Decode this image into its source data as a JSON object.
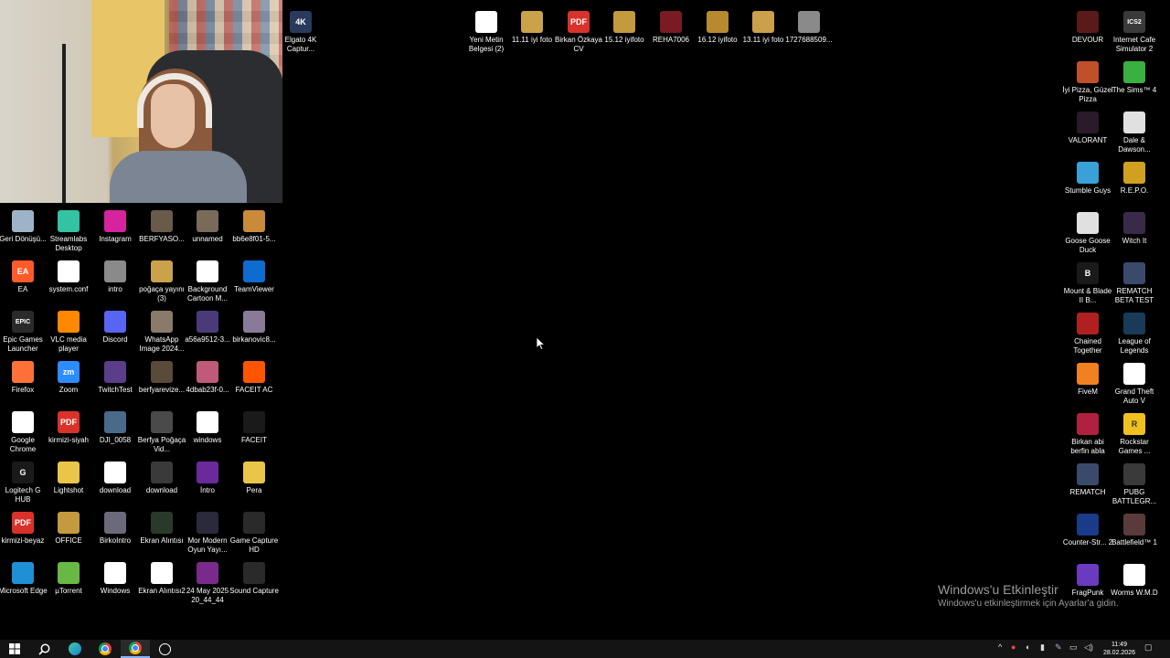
{
  "desktop": {
    "top_icons": [
      {
        "label": "Elgato 4K Captur...",
        "color": "#2a3a5c",
        "glyph": "4K"
      },
      {
        "label": "Yeni Metin Belgesi (2)",
        "color": "#ffffff",
        "glyph": ""
      },
      {
        "label": "11.11 iyi foto",
        "color": "#c9a24a",
        "glyph": ""
      },
      {
        "label": "Birkan Özkaya CV",
        "color": "#d9322a",
        "glyph": "PDF"
      },
      {
        "label": "15.12 iyifoto",
        "color": "#c49a3e",
        "glyph": ""
      },
      {
        "label": "REHA7006",
        "color": "#7a1a22",
        "glyph": ""
      },
      {
        "label": "16.12 iyifoto",
        "color": "#b88a30",
        "glyph": ""
      },
      {
        "label": "13.11 iyi foto",
        "color": "#caa04a",
        "glyph": ""
      },
      {
        "label": "1727688509...",
        "color": "#8a8a8a",
        "glyph": ""
      }
    ],
    "left_icons": [
      [
        {
          "label": "Geri Dönüşü...",
          "color": "#9fb3c8",
          "glyph": ""
        },
        {
          "label": "EA",
          "color": "#ff5a2a",
          "glyph": "EA"
        },
        {
          "label": "Epic Games Launcher",
          "color": "#2a2a2a",
          "glyph": "EPIC"
        },
        {
          "label": "Firefox",
          "color": "#ff7139",
          "glyph": ""
        },
        {
          "label": "Google Chrome",
          "color": "#ffffff",
          "glyph": ""
        },
        {
          "label": "Logitech G HUB",
          "color": "#1a1a1a",
          "glyph": "G"
        },
        {
          "label": "kirmizi-beyaz",
          "color": "#d9322a",
          "glyph": "PDF"
        },
        {
          "label": "Microsoft Edge",
          "color": "#1f8fd6",
          "glyph": ""
        }
      ],
      [
        {
          "label": "Streamlabs Desktop",
          "color": "#31c3a2",
          "glyph": ""
        },
        {
          "label": "system.conf",
          "color": "#ffffff",
          "glyph": ""
        },
        {
          "label": "VLC media player",
          "color": "#ff8800",
          "glyph": ""
        },
        {
          "label": "Zoom",
          "color": "#2d8cff",
          "glyph": "zm"
        },
        {
          "label": "kirmizi-siyah",
          "color": "#d9322a",
          "glyph": "PDF"
        },
        {
          "label": "Lightshot",
          "color": "#e9c54a",
          "glyph": ""
        },
        {
          "label": "OFFICE",
          "color": "#c49a3e",
          "glyph": ""
        },
        {
          "label": "µTorrent",
          "color": "#68b846",
          "glyph": ""
        }
      ],
      [
        {
          "label": "Instagram",
          "color": "#d6249f",
          "glyph": ""
        },
        {
          "label": "intro",
          "color": "#8a8a8a",
          "glyph": ""
        },
        {
          "label": "Discord",
          "color": "#5865f2",
          "glyph": ""
        },
        {
          "label": "TwitchTest",
          "color": "#5a3e8a",
          "glyph": ""
        },
        {
          "label": "DJI_0058",
          "color": "#4a6a8a",
          "glyph": ""
        },
        {
          "label": "download",
          "color": "#ffffff",
          "glyph": ""
        },
        {
          "label": "BirkoIntro",
          "color": "#6a6a7a",
          "glyph": ""
        },
        {
          "label": "Windows",
          "color": "#ffffff",
          "glyph": ""
        }
      ],
      [
        {
          "label": "BERFYASO...",
          "color": "#6a5a4a",
          "glyph": ""
        },
        {
          "label": "poğaça yayını (3)",
          "color": "#c9a24a",
          "glyph": ""
        },
        {
          "label": "WhatsApp Image 2024...",
          "color": "#8a7a6a",
          "glyph": ""
        },
        {
          "label": "berfyarevize...",
          "color": "#5a4a3a",
          "glyph": ""
        },
        {
          "label": "Berfya Poğaça Vid...",
          "color": "#4a4a4a",
          "glyph": ""
        },
        {
          "label": "download",
          "color": "#3a3a3a",
          "glyph": ""
        },
        {
          "label": "Ekran Alıntısı",
          "color": "#2a3a2a",
          "glyph": ""
        },
        {
          "label": "Ekran Alıntısı2",
          "color": "#ffffff",
          "glyph": ""
        }
      ],
      [
        {
          "label": "unnamed",
          "color": "#7a6a5a",
          "glyph": ""
        },
        {
          "label": "Background Cartoon M...",
          "color": "#ffffff",
          "glyph": ""
        },
        {
          "label": "a56a9512-3...",
          "color": "#4a3a7a",
          "glyph": ""
        },
        {
          "label": "4dbab23f-0...",
          "color": "#c05a7a",
          "glyph": ""
        },
        {
          "label": "windows",
          "color": "#ffffff",
          "glyph": ""
        },
        {
          "label": "İntro",
          "color": "#6a2a9a",
          "glyph": ""
        },
        {
          "label": "Mor Modern Oyun Yayı...",
          "color": "#2a2a3a",
          "glyph": ""
        },
        {
          "label": "24 May 2025 20_44_44",
          "color": "#7a2a8a",
          "glyph": ""
        }
      ],
      [
        {
          "label": "bb6e8f01-5...",
          "color": "#c98a3a",
          "glyph": ""
        },
        {
          "label": "TeamViewer",
          "color": "#0e6bd0",
          "glyph": ""
        },
        {
          "label": "birkanovic8...",
          "color": "#8a7a9a",
          "glyph": ""
        },
        {
          "label": "FACEIT AC",
          "color": "#ff5500",
          "glyph": ""
        },
        {
          "label": "FACEIT",
          "color": "#1a1a1a",
          "glyph": ""
        },
        {
          "label": "Pera",
          "color": "#e9c54a",
          "glyph": ""
        },
        {
          "label": "Game Capture HD",
          "color": "#2a2a2a",
          "glyph": ""
        },
        {
          "label": "Sound Capture",
          "color": "#2a2a2a",
          "glyph": ""
        }
      ]
    ],
    "right_icons": [
      [
        {
          "label": "DEVOUR",
          "color": "#5a1a1a",
          "glyph": ""
        },
        {
          "label": "İyi Pizza, Güzel Pizza",
          "color": "#c0502a",
          "glyph": ""
        },
        {
          "label": "VALORANT",
          "color": "#2a1a2a",
          "glyph": ""
        },
        {
          "label": "Stumble Guys",
          "color": "#3aa0d8",
          "glyph": ""
        },
        {
          "label": "Goose Goose Duck",
          "color": "#e0e0e0",
          "glyph": ""
        },
        {
          "label": "Mount & Blade II B...",
          "color": "#1a1a1a",
          "glyph": "B"
        },
        {
          "label": "Chained Together",
          "color": "#b02020",
          "glyph": ""
        },
        {
          "label": "FiveM",
          "color": "#f08020",
          "glyph": ""
        },
        {
          "label": "Birkan abi berfin abla",
          "color": "#b02040",
          "glyph": ""
        },
        {
          "label": "REMATCH",
          "color": "#3a4a6a",
          "glyph": ""
        },
        {
          "label": "Counter-Str... 2",
          "color": "#1a3a8a",
          "glyph": ""
        },
        {
          "label": "FragPunk",
          "color": "#6a3ac0",
          "glyph": ""
        }
      ],
      [
        {
          "label": "Internet Cafe Simulator 2",
          "color": "#3a3a3a",
          "glyph": "ICS2"
        },
        {
          "label": "The Sims™ 4",
          "color": "#3ab040",
          "glyph": ""
        },
        {
          "label": "Dale & Dawson...",
          "color": "#e0e0e0",
          "glyph": ""
        },
        {
          "label": "R.E.P.O.",
          "color": "#d0a020",
          "glyph": ""
        },
        {
          "label": "Witch It",
          "color": "#3a2a4a",
          "glyph": ""
        },
        {
          "label": "REMATCH BETA TEST",
          "color": "#3a4a6a",
          "glyph": ""
        },
        {
          "label": "League of Legends",
          "color": "#1a3a5a",
          "glyph": ""
        },
        {
          "label": "Grand Theft Auto V",
          "color": "#ffffff",
          "glyph": ""
        },
        {
          "label": "Rockstar Games ...",
          "color": "#f0c020",
          "glyph": "R"
        },
        {
          "label": "PUBG BATTLEGR...",
          "color": "#3a3a3a",
          "glyph": ""
        },
        {
          "label": "Battlefield™ 1",
          "color": "#5a3a3a",
          "glyph": ""
        },
        {
          "label": "Worms W.M.D",
          "color": "#ffffff",
          "glyph": ""
        }
      ]
    ]
  },
  "watermark": {
    "title": "Windows'u Etkinleştir",
    "subtitle": "Windows'u etkinleştirmek için Ayarlar'a gidin."
  },
  "taskbar": {
    "clock_time": "11:49",
    "clock_date": "28.02.2026"
  }
}
